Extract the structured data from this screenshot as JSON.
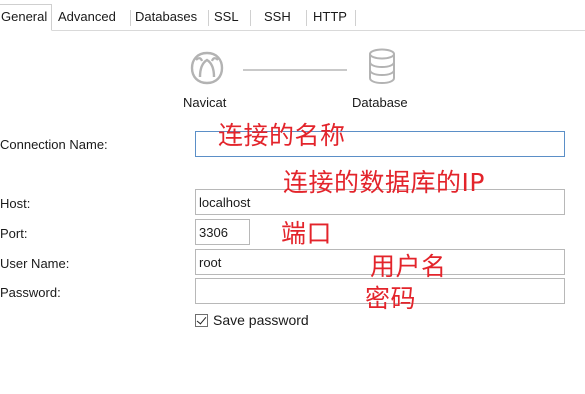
{
  "tabs": [
    {
      "label": "General",
      "active": true
    },
    {
      "label": "Advanced"
    },
    {
      "label": "Databases"
    },
    {
      "label": "SSL"
    },
    {
      "label": "SSH"
    },
    {
      "label": "HTTP"
    }
  ],
  "connection_diagram": {
    "left_label": "Navicat",
    "left_icon": "navicat-logo-icon",
    "right_label": "Database",
    "right_icon": "database-icon"
  },
  "form": {
    "connection_name": {
      "label": "Connection Name:",
      "value": ""
    },
    "host": {
      "label": "Host:",
      "value": "localhost"
    },
    "port": {
      "label": "Port:",
      "value": "3306"
    },
    "user_name": {
      "label": "User Name:",
      "value": "root"
    },
    "password": {
      "label": "Password:",
      "value": ""
    },
    "save_password": {
      "label": "Save password",
      "checked": true
    }
  },
  "annotations": {
    "connection_name_note": "连接的名称",
    "host_note": "连接的数据库的IP",
    "port_note": "端口",
    "user_note": "用户名",
    "password_note": "密码"
  },
  "colors": {
    "annotation": "#e3242b",
    "focus_border": "#5b8fc7"
  }
}
